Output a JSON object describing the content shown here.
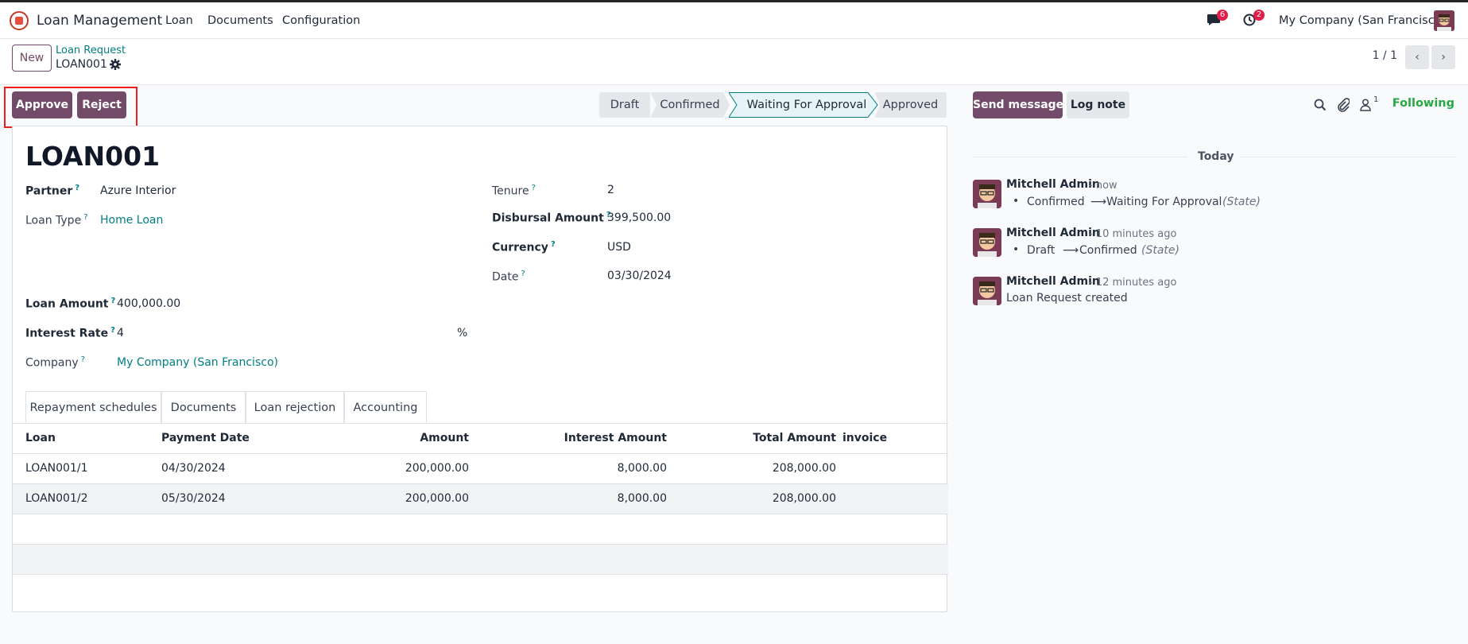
{
  "navbar": {
    "app_title": "Loan Management",
    "menus": [
      "Loan",
      "Documents",
      "Configuration"
    ],
    "messages_badge": "6",
    "activities_badge": "2",
    "company": "My Company (San Francisco)"
  },
  "control_panel": {
    "new_label": "New",
    "breadcrumb_parent": "Loan Request",
    "breadcrumb_current": "LOAN001",
    "pager": "1 / 1",
    "prev_glyph": "‹",
    "next_glyph": "›"
  },
  "statusbar": {
    "buttons": [
      "Approve",
      "Reject"
    ],
    "stages": [
      "Draft",
      "Confirmed",
      "Waiting For Approval",
      "Approved"
    ],
    "current_stage": "Waiting For Approval"
  },
  "form": {
    "title": "LOAN001",
    "help_mark": "?",
    "left_fields": [
      {
        "label": "Partner",
        "value": "Azure Interior"
      },
      {
        "label": "Loan Type",
        "value": "Home Loan"
      }
    ],
    "right_fields": [
      {
        "label": "Tenure",
        "value": "2"
      },
      {
        "label": "Disbursal Amount",
        "value": "399,500.00"
      },
      {
        "label": "Currency",
        "value": "USD"
      },
      {
        "label": "Date",
        "value": "03/30/2024"
      }
    ],
    "lower_fields": [
      {
        "label": "Loan Amount",
        "value": "400,000.00"
      },
      {
        "label": "Interest Rate",
        "value": "4",
        "suffix": "%"
      },
      {
        "label": "Company",
        "value": "My Company (San Francisco)"
      }
    ],
    "tabs": [
      "Repayment schedules",
      "Documents",
      "Loan rejection",
      "Accounting"
    ],
    "table": {
      "headers": [
        "Loan",
        "Payment Date",
        "Amount",
        "Interest Amount",
        "Total Amount",
        "invoice"
      ],
      "rows": [
        [
          "LOAN001/1",
          "04/30/2024",
          "200,000.00",
          "8,000.00",
          "208,000.00",
          ""
        ],
        [
          "LOAN001/2",
          "05/30/2024",
          "200,000.00",
          "8,000.00",
          "208,000.00",
          ""
        ]
      ]
    }
  },
  "chatter": {
    "send_message": "Send message",
    "log_note": "Log note",
    "followers_count": "1",
    "following_label": "Following",
    "day_separator": "Today",
    "arrow": "⟶",
    "messages": [
      {
        "author": "Mitchell Admin",
        "time": "- now",
        "from": "Confirmed",
        "to": "Waiting For Approval",
        "field": "(State)"
      },
      {
        "author": "Mitchell Admin",
        "time": "- 10 minutes ago",
        "from": "Draft",
        "to": "Confirmed",
        "field": "(State)"
      },
      {
        "author": "Mitchell Admin",
        "time": "- 12 minutes ago",
        "text": "Loan Request created"
      }
    ]
  },
  "icons": {
    "logo": "app-logo-icon",
    "messages": "chat-bubble-icon",
    "activities": "clock-icon",
    "gear": "gear-icon",
    "search": "search-icon",
    "attachment": "paperclip-icon",
    "followers": "user-icon"
  },
  "colors": {
    "primary": "#714b67",
    "link": "#017e84",
    "highlight": "#ef1c1c",
    "badge": "#e11d48",
    "following": "#28a745"
  }
}
